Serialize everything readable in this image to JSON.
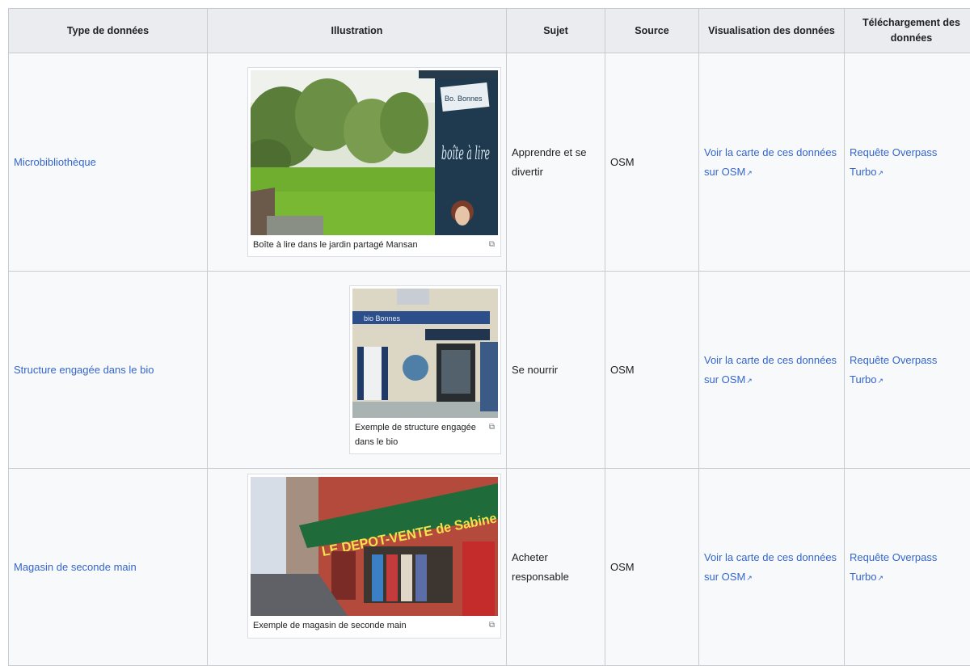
{
  "headers": {
    "type": "Type de données",
    "illustration": "Illustration",
    "sujet": "Sujet",
    "source": "Source",
    "visualisation": "Visualisation des données",
    "telechargement": "Téléchargement des données"
  },
  "rows": [
    {
      "type": "Microbibliothèque",
      "caption": "Boîte à lire dans le jardin partagé Mansan",
      "sujet": "Apprendre et se divertir",
      "source": "OSM",
      "visualisation": "Voir la carte de ces données sur OSM",
      "telechargement": "Requête Overpass Turbo"
    },
    {
      "type": "Structure engagée dans le bio",
      "caption": "Exemple de structure engagée dans le bio",
      "sujet": "Se nourrir",
      "source": "OSM",
      "visualisation": "Voir la carte de ces données sur OSM",
      "telechargement": "Requête Overpass Turbo"
    },
    {
      "type": "Magasin de seconde main",
      "caption": "Exemple de magasin de seconde main",
      "sujet": "Acheter responsable",
      "source": "OSM",
      "visualisation": "Voir la carte de ces données sur OSM",
      "telechargement": "Requête Overpass Turbo"
    }
  ],
  "photos": {
    "sign_text_top": "Bo. Bonnes",
    "sign_text_main": "boîte à lire",
    "shop_sign_text": "bio Bonnes",
    "store_banner": "LE DEPOT-VENTE de Sabine"
  },
  "icons": {
    "external_link": "external-link-icon",
    "enlarge": "enlarge-icon"
  },
  "colors": {
    "link": "#3366cc",
    "header_bg": "#eaecf0",
    "cell_bg": "#f8f9fa",
    "border": "#c8ccd1"
  }
}
